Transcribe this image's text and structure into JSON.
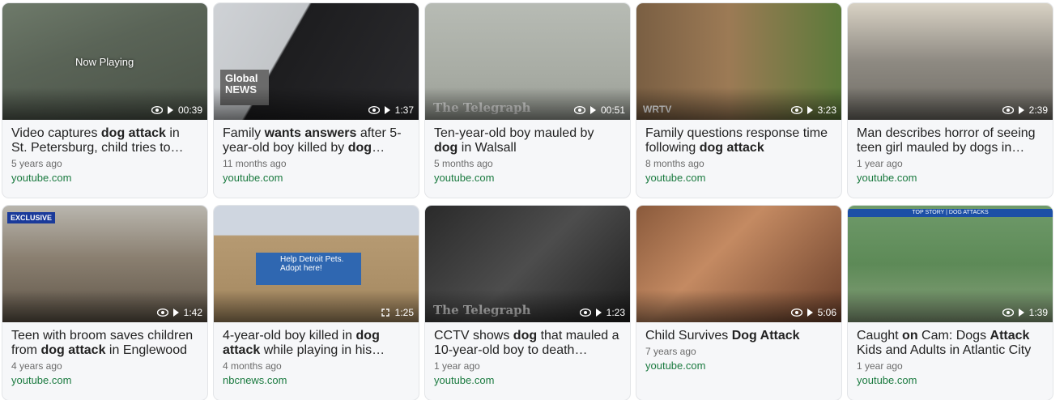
{
  "cards": [
    {
      "title_parts": [
        {
          "t": "Video captures ",
          "b": false
        },
        {
          "t": "dog attack",
          "b": true
        },
        {
          "t": " in St. Petersburg, child tries to…",
          "b": false
        }
      ],
      "age": "5 years ago",
      "source": "youtube.com",
      "duration": "00:39",
      "overlay": "Now Playing",
      "thumb_icon": "play-icon"
    },
    {
      "title_parts": [
        {
          "t": "Family ",
          "b": false
        },
        {
          "t": "wants answers",
          "b": true
        },
        {
          "t": " after 5-year-old boy killed by ",
          "b": false
        },
        {
          "t": "dog",
          "b": true
        },
        {
          "t": "…",
          "b": false
        }
      ],
      "age": "11 months ago",
      "source": "youtube.com",
      "duration": "1:37",
      "overlay": "Global NEWS",
      "thumb_icon": "play-icon"
    },
    {
      "title_parts": [
        {
          "t": "Ten-year-old boy mauled by ",
          "b": false
        },
        {
          "t": "dog",
          "b": true
        },
        {
          "t": " in Walsall",
          "b": false
        }
      ],
      "age": "5 months ago",
      "source": "youtube.com",
      "duration": "00:51",
      "overlay": "The Telegraph",
      "thumb_icon": "play-icon"
    },
    {
      "title_parts": [
        {
          "t": "Family questions response time following ",
          "b": false
        },
        {
          "t": "dog attack",
          "b": true
        }
      ],
      "age": "8 months ago",
      "source": "youtube.com",
      "duration": "3:23",
      "overlay": "WRTV",
      "thumb_icon": "play-icon"
    },
    {
      "title_parts": [
        {
          "t": "Man describes horror of seeing teen girl mauled by dogs in…",
          "b": false
        }
      ],
      "age": "1 year ago",
      "source": "youtube.com",
      "duration": "2:39",
      "overlay": "",
      "thumb_icon": "play-icon"
    },
    {
      "title_parts": [
        {
          "t": "Teen with broom saves children from ",
          "b": false
        },
        {
          "t": "dog attack",
          "b": true
        },
        {
          "t": " in Englewood",
          "b": false
        }
      ],
      "age": "4 years ago",
      "source": "youtube.com",
      "duration": "1:42",
      "overlay": "EXCLUSIVE",
      "thumb_icon": "play-icon"
    },
    {
      "title_parts": [
        {
          "t": "4-year-old boy killed in ",
          "b": false
        },
        {
          "t": "dog attack",
          "b": true
        },
        {
          "t": " while playing in his…",
          "b": false
        }
      ],
      "age": "4 months ago",
      "source": "nbcnews.com",
      "duration": "1:25",
      "overlay": "Help Detroit Pets. Adopt here!",
      "thumb_icon": "expand-icon"
    },
    {
      "title_parts": [
        {
          "t": "CCTV shows ",
          "b": false
        },
        {
          "t": "dog",
          "b": true
        },
        {
          "t": " that mauled a 10-year-old boy to death…",
          "b": false
        }
      ],
      "age": "1 year ago",
      "source": "youtube.com",
      "duration": "1:23",
      "overlay": "The Telegraph",
      "thumb_icon": "play-icon"
    },
    {
      "title_parts": [
        {
          "t": "Child Survives ",
          "b": false
        },
        {
          "t": "Dog Attack",
          "b": true
        }
      ],
      "age": "7 years ago",
      "source": "youtube.com",
      "duration": "5:06",
      "overlay": "",
      "thumb_icon": "play-icon"
    },
    {
      "title_parts": [
        {
          "t": "Caught ",
          "b": false
        },
        {
          "t": "on",
          "b": true
        },
        {
          "t": " Cam: Dogs ",
          "b": false
        },
        {
          "t": "Attack",
          "b": true
        },
        {
          "t": " Kids and Adults in Atlantic City",
          "b": false
        }
      ],
      "age": "1 year ago",
      "source": "youtube.com",
      "duration": "1:39",
      "overlay": "TOP STORY | DOG ATTACKS",
      "thumb_icon": "play-icon"
    }
  ],
  "colors": {
    "source": "#1a7a3f",
    "age": "#6b6b6b",
    "title": "#222222"
  }
}
